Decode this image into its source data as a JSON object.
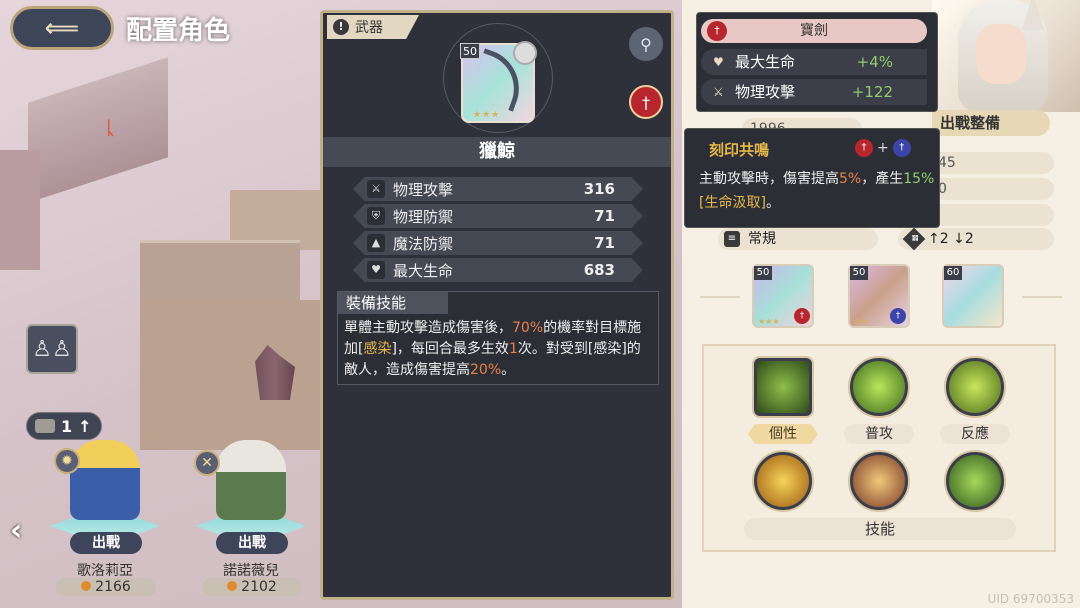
{
  "header": {
    "back_icon": "back-arrow-icon",
    "title": "配置角色"
  },
  "scene": {
    "move_count": "1",
    "rune": "ᚳ"
  },
  "characters": [
    {
      "name": "歌洛莉亞",
      "power": "2166",
      "deploy_label": "出戰",
      "element_icon": "sun-icon"
    },
    {
      "name": "諾諾薇兒",
      "power": "2102",
      "deploy_label": "出戰",
      "element_icon": "wind-icon"
    }
  ],
  "weapon_panel": {
    "tag": "武器",
    "level": "50",
    "name": "獵鯨",
    "stars": "★★★",
    "stats": [
      {
        "icon": "sword-icon",
        "label": "物理攻擊",
        "value": "316"
      },
      {
        "icon": "shield-icon",
        "label": "物理防禦",
        "value": "71"
      },
      {
        "icon": "hat-icon",
        "label": "魔法防禦",
        "value": "71"
      },
      {
        "icon": "heart-icon",
        "label": "最大生命",
        "value": "683"
      }
    ],
    "skill_title": "裝備技能",
    "skill_desc": {
      "p1": "單體主動攻擊造成傷害後，",
      "pct1": "70%",
      "p2": "的機率對目標施加[",
      "status": "感染",
      "p3": "]，每回合最多生效",
      "times": "1",
      "p4": "次。對受到[感染]的敵人，造成傷害提高",
      "pct2": "20%",
      "p5": "。"
    }
  },
  "tooltip": {
    "title": "寶劍",
    "rows": [
      {
        "label": "最大生命",
        "value": "+4%"
      },
      {
        "label": "物理攻擊",
        "value": "+122"
      }
    ]
  },
  "resonance": {
    "title": "刻印共鳴",
    "plus": "+",
    "desc_a": "主動攻擊時，傷害提高",
    "pct": "5%",
    "desc_b": "，產生",
    "pct2": "15%",
    "desc_c": "[生命汲取]",
    "desc_d": "。"
  },
  "right_panel": {
    "deploy_ready": "出戰整備",
    "partial_stats": [
      "1996",
      "45",
      "0"
    ],
    "mode": "常規",
    "move": "↑2 ↓2",
    "equip": [
      {
        "level": "50",
        "stars": "★★★"
      },
      {
        "level": "50",
        "stars": "★★"
      },
      {
        "level": "60",
        "stars": ""
      }
    ],
    "skills": [
      {
        "label": "個性",
        "icon": "personality-skill-icon"
      },
      {
        "label": "普攻",
        "icon": "normal-attack-icon"
      },
      {
        "label": "反應",
        "icon": "reaction-icon"
      }
    ],
    "skills_bar": "技能",
    "uid": "UID 69700353"
  }
}
